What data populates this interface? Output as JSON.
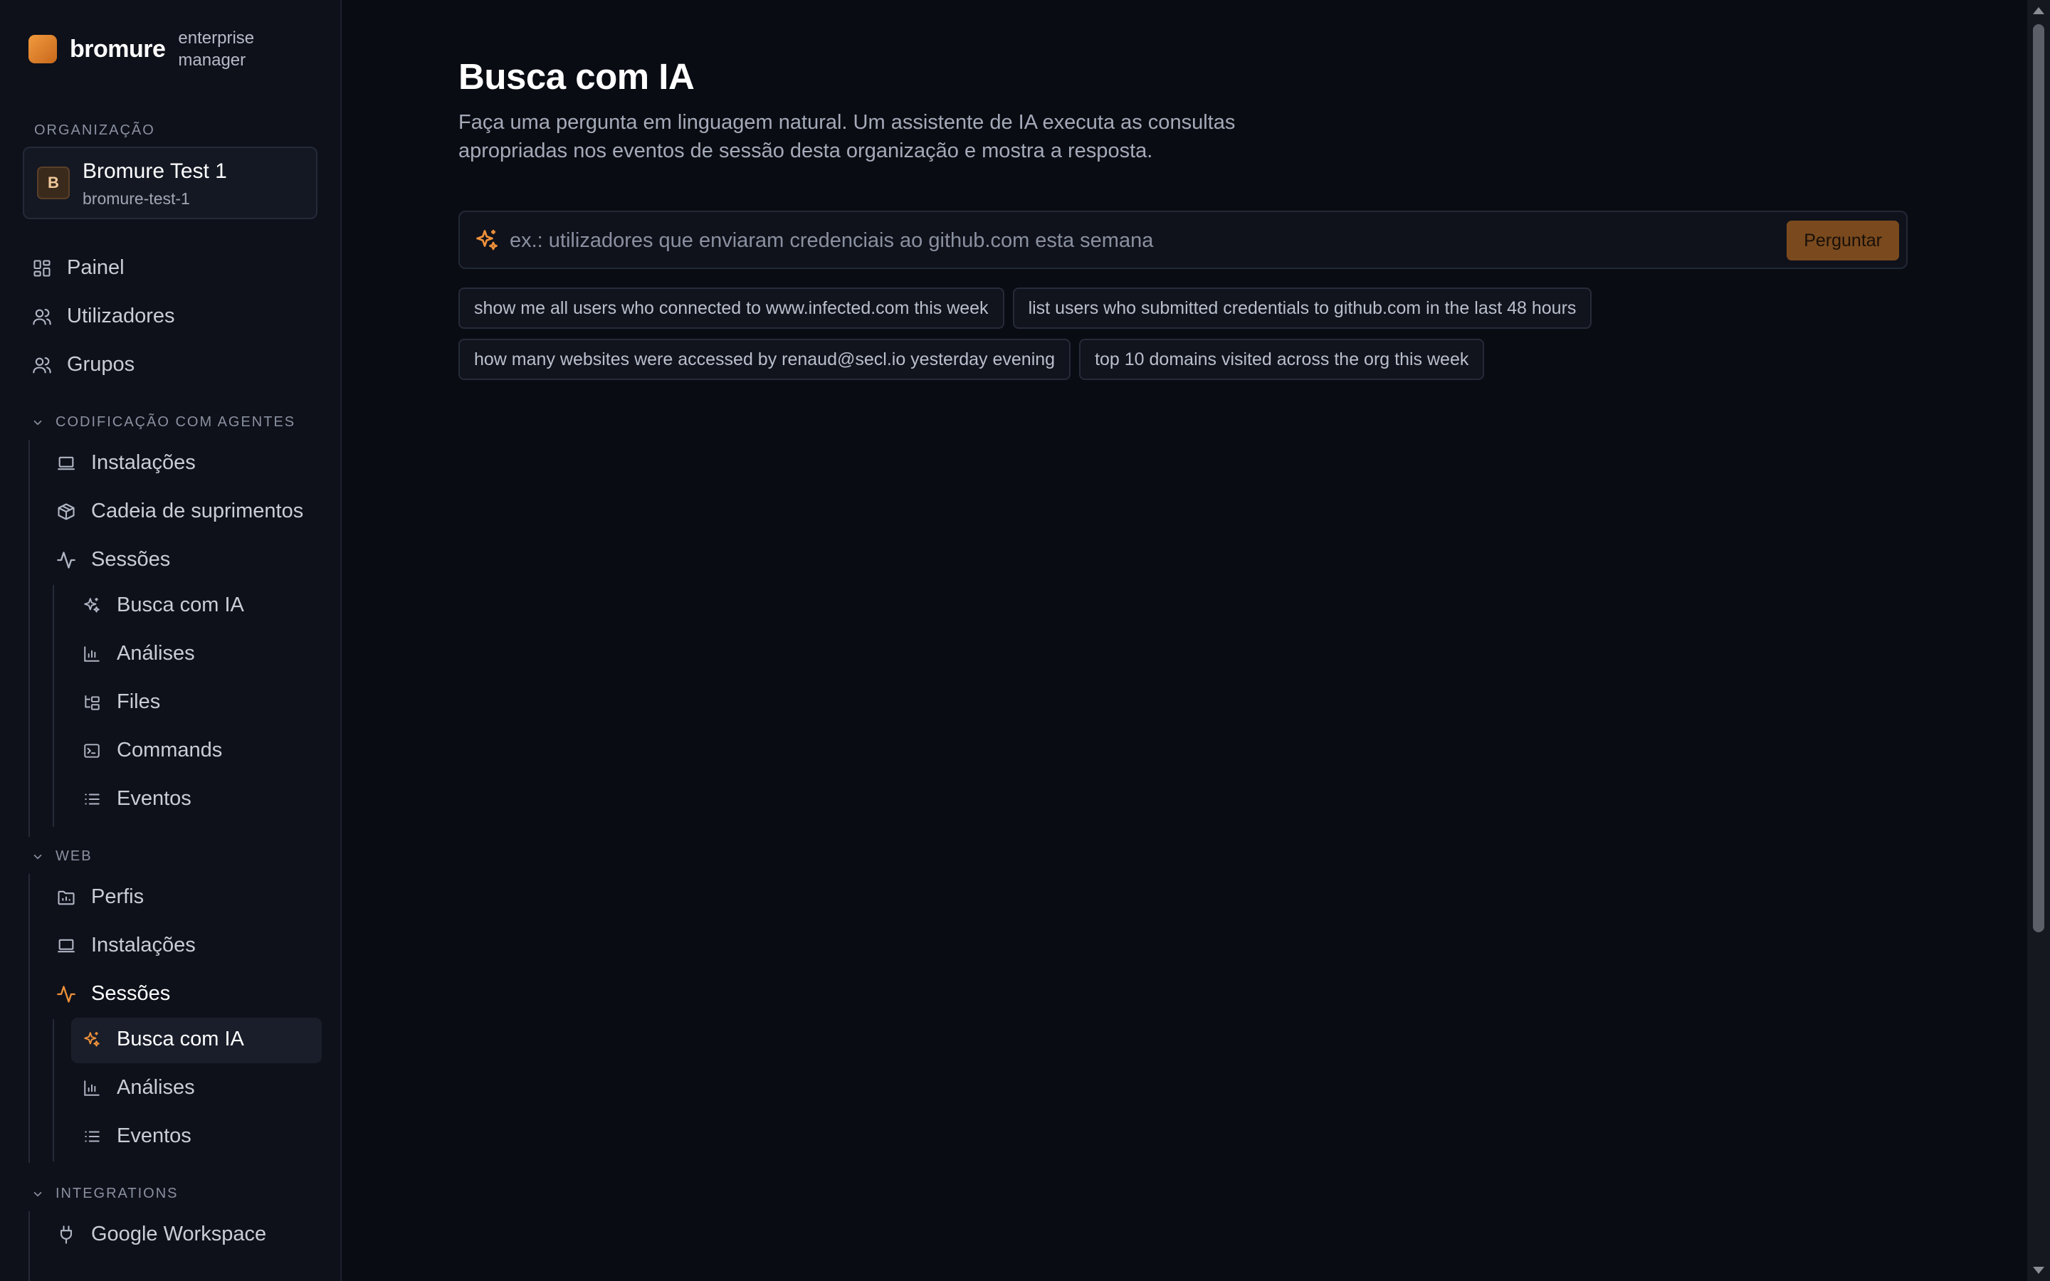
{
  "brand": {
    "name": "bromure",
    "subtitle_line1": "enterprise",
    "subtitle_line2": "manager"
  },
  "organization": {
    "section_label": "ORGANIZAÇÃO",
    "avatar": "B",
    "name": "Bromure Test 1",
    "slug": "bromure-test-1"
  },
  "nav": {
    "top": [
      {
        "label": "Painel",
        "icon": "dashboard-icon"
      },
      {
        "label": "Utilizadores",
        "icon": "users-icon"
      },
      {
        "label": "Grupos",
        "icon": "group-icon"
      }
    ],
    "coding_group": {
      "title": "CODIFICAÇÃO COM AGENTES",
      "items": [
        {
          "label": "Instalações",
          "icon": "laptop-icon"
        },
        {
          "label": "Cadeia de suprimentos",
          "icon": "package-icon"
        },
        {
          "label": "Sessões",
          "icon": "activity-icon"
        }
      ],
      "sessions_children": [
        {
          "label": "Busca com IA",
          "icon": "sparkles-icon"
        },
        {
          "label": "Análises",
          "icon": "bar-chart-icon"
        },
        {
          "label": "Files",
          "icon": "folder-tree-icon"
        },
        {
          "label": "Commands",
          "icon": "terminal-icon"
        },
        {
          "label": "Eventos",
          "icon": "list-icon"
        }
      ]
    },
    "web_group": {
      "title": "WEB",
      "items": [
        {
          "label": "Perfis",
          "icon": "folder-icon"
        },
        {
          "label": "Instalações",
          "icon": "laptop-icon"
        },
        {
          "label": "Sessões",
          "icon": "activity-icon"
        }
      ],
      "sessions_children": [
        {
          "label": "Busca com IA",
          "icon": "sparkles-icon"
        },
        {
          "label": "Análises",
          "icon": "bar-chart-icon"
        },
        {
          "label": "Eventos",
          "icon": "list-icon"
        }
      ]
    },
    "integrations_group": {
      "title": "INTEGRATIONS",
      "items": [
        {
          "label": "Google Workspace",
          "icon": "plug-icon"
        }
      ]
    }
  },
  "page": {
    "title": "Busca com IA",
    "description": "Faça uma pergunta em linguagem natural. Um assistente de IA executa as consultas apropriadas nos eventos de sessão desta organização e mostra a resposta.",
    "search": {
      "placeholder": "ex.: utilizadores que enviaram credenciais ao github.com esta semana",
      "value": "",
      "button_label": "Perguntar"
    },
    "suggestions": [
      "show me all users who connected to www.infected.com this week",
      "list users who submitted credentials to github.com in the last 48 hours",
      "how many websites were accessed by renaud@secl.io yesterday evening",
      "top 10 domains visited across the org this week"
    ]
  },
  "colors": {
    "accent": "#f0913a",
    "background": "#0a0c13",
    "sidebar": "#0e111a",
    "button": "#7a4a1e"
  }
}
